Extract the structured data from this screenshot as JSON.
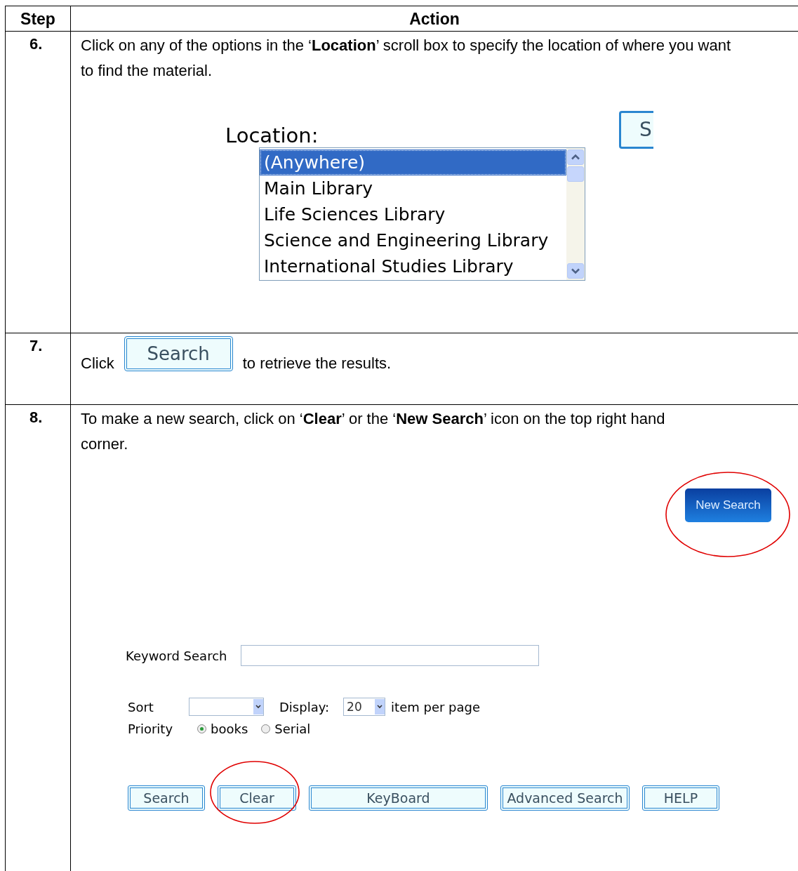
{
  "table": {
    "columns": [
      "Step",
      "Action"
    ],
    "rows": [
      {
        "kind": "location",
        "step": "6.",
        "instruction": "Click on any of the options in the ‘**Location**’ scroll box to specify the location of where you want to find the material.",
        "location_label": "Location:",
        "options": [
          {
            "label": "(Anywhere)",
            "selected": true
          },
          {
            "label": "Main Library",
            "selected": false
          },
          {
            "label": "Life Sciences Library",
            "selected": false
          },
          {
            "label": "Science and Engineering Library",
            "selected": false
          },
          {
            "label": "International Studies Library",
            "selected": false
          }
        ],
        "cut_button": "S"
      },
      {
        "kind": "click",
        "step": "7.",
        "text_before": "Click",
        "button": "Search",
        "text_after": "to retrieve the results."
      },
      {
        "kind": "form",
        "step": "8.",
        "instruction": "To make a new search, click on ‘**Clear**’ or the ‘**New Search**’ icon on the top right hand corner.",
        "new_search": {
          "label": "New Search",
          "highlighted": true
        },
        "keyword_label": "Keyword Search",
        "sort_label": "Sort",
        "display_label": "Display:",
        "display_value": "20",
        "per_page": "item per page",
        "priority_label": "Priority",
        "radios": [
          {
            "label": "books",
            "selected": true
          },
          {
            "label": "Serial",
            "selected": false
          }
        ],
        "buttons": [
          {
            "label": "Search",
            "highlighted": false
          },
          {
            "label": "Clear",
            "highlighted": true
          },
          {
            "label": "KeyBoard",
            "highlighted": false
          },
          {
            "label": "Advanced Search",
            "highlighted": false
          },
          {
            "label": "HELP",
            "highlighted": false
          }
        ]
      }
    ]
  }
}
